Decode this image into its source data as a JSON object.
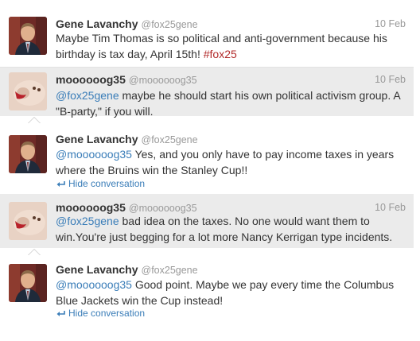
{
  "tweets": [
    {
      "name": "Gene Lavanchy",
      "handle": "@fox25gene",
      "time": "10 Feb",
      "text_a": "Maybe Tim Thomas is so political and anti-government because his birthday is tax day, April 15th! ",
      "hashtag": "#fox25"
    },
    {
      "name": "moooooog35",
      "handle": "@moooooog35",
      "time": "10 Feb",
      "mention": "@fox25gene",
      "text": " maybe he should start his own political activism group. A \"B-party,\" if you will."
    },
    {
      "name": "Gene Lavanchy",
      "handle": "@fox25gene",
      "mention": "@moooooog35",
      "text": " Yes, and you only have to pay income taxes in years where the Bruins win the Stanley Cup!!",
      "hide_label": "Hide conversation"
    },
    {
      "name": "moooooog35",
      "handle": "@moooooog35",
      "time": "10 Feb",
      "mention": "@fox25gene",
      "text": " bad idea on the taxes. No one would want them to win.You're just begging for a lot more Nancy Kerrigan type incidents."
    },
    {
      "name": "Gene Lavanchy",
      "handle": "@fox25gene",
      "mention": "@moooooog35",
      "text": " Good point. Maybe we pay every time the Columbus Blue Jackets win the Cup instead!",
      "hide_label": "Hide conversation"
    }
  ],
  "colors": {
    "link": "#3a7db8",
    "hashtag": "#b22b2b",
    "gray_bg": "#ebebeb"
  },
  "icons": {
    "hide": "conversation-arrow-icon",
    "avatar_gene": "man-in-suit-avatar",
    "avatar_moog": "stuffed-toy-avatar"
  }
}
